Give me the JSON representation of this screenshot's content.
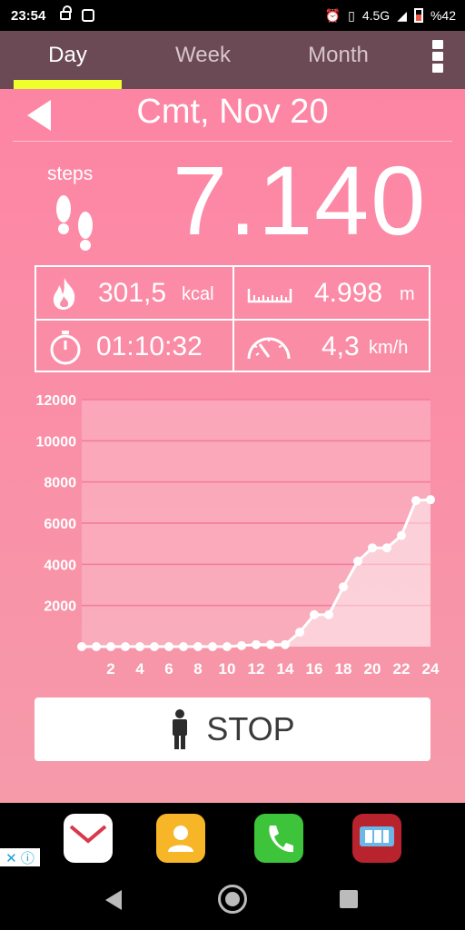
{
  "status_bar": {
    "time": "23:54",
    "network": "4.5G",
    "battery": "%42"
  },
  "tabs": [
    {
      "label": "Day"
    },
    {
      "label": "Week"
    },
    {
      "label": "Month"
    }
  ],
  "date": {
    "title": "Cmt, Nov 20"
  },
  "steps": {
    "label": "steps",
    "value": "7.140"
  },
  "stats": {
    "calories": {
      "value": "301,5",
      "unit": "kcal"
    },
    "distance": {
      "value": "4.998",
      "unit": "m"
    },
    "duration": {
      "value": "01:10:32"
    },
    "speed": {
      "value": "4,3",
      "unit": "km/h"
    }
  },
  "chart_data": {
    "type": "line",
    "ylim": [
      0,
      12000
    ],
    "yticks": [
      "2000",
      "4000",
      "6000",
      "8000",
      "10000",
      "12000"
    ],
    "xticks": [
      "2",
      "4",
      "6",
      "8",
      "10",
      "12",
      "14",
      "16",
      "18",
      "20",
      "22",
      "24"
    ],
    "xlim": [
      0,
      24
    ],
    "series": [
      {
        "x": [
          0,
          1,
          2,
          3,
          4,
          5,
          6,
          7,
          8,
          9,
          10,
          11,
          12,
          13,
          14,
          15,
          16,
          17,
          18,
          19,
          20,
          21,
          22,
          23,
          24
        ],
        "values": [
          0,
          0,
          0,
          0,
          0,
          0,
          0,
          0,
          0,
          0,
          0,
          50,
          100,
          100,
          100,
          700,
          1550,
          1550,
          2900,
          4150,
          4800,
          4800,
          5400,
          7100,
          7140
        ]
      }
    ]
  },
  "stop_button": {
    "label": "STOP"
  },
  "ad": {
    "badge": "✕ ⓘ"
  },
  "dock_apps": [
    {
      "icon": "mail-icon"
    },
    {
      "icon": "contacts-icon"
    },
    {
      "icon": "phone-icon"
    },
    {
      "icon": "yalla-101-okey-icon"
    }
  ]
}
